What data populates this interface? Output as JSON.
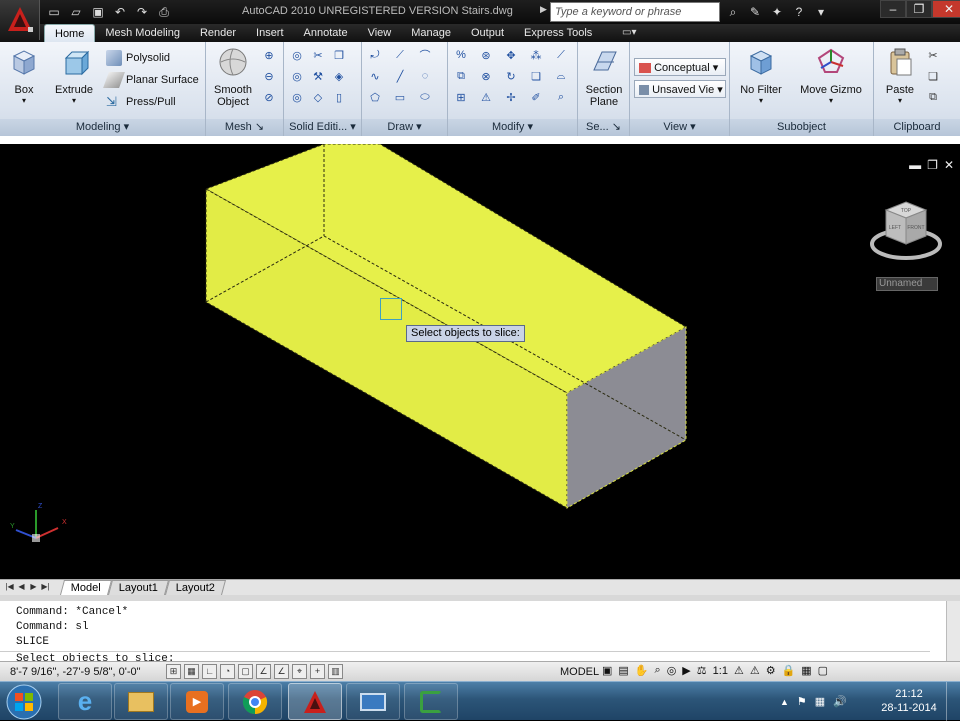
{
  "window": {
    "title": "AutoCAD 2010    UNREGISTERED VERSION         Stairs.dwg",
    "search_placeholder": "Type a keyword or phrase",
    "controls": [
      "minimize",
      "restore",
      "close"
    ]
  },
  "qat": {
    "icons": [
      "new-icon",
      "open-icon",
      "save-icon",
      "undo-icon",
      "redo-icon",
      "plot-icon"
    ]
  },
  "ribbon": {
    "tabs": [
      "Home",
      "Mesh Modeling",
      "Render",
      "Insert",
      "Annotate",
      "View",
      "Manage",
      "Output",
      "Express Tools"
    ],
    "active_tab": "Home",
    "panels": {
      "modeling": {
        "title": "Modeling",
        "box": "Box",
        "extrude": "Extrude",
        "polysolid": "Polysolid",
        "planar_surface": "Planar Surface",
        "press_pull": "Press/Pull"
      },
      "mesh": {
        "title": "Mesh",
        "smooth_object_1": "Smooth",
        "smooth_object_2": "Object"
      },
      "solid_editing": {
        "title": "Solid Editi..."
      },
      "draw": {
        "title": "Draw"
      },
      "modify": {
        "title": "Modify"
      },
      "section": {
        "title": "Se...",
        "section_plane_1": "Section",
        "section_plane_2": "Plane"
      },
      "view": {
        "title": "View",
        "visual_style": "Conceptual",
        "named_view": "Unsaved Vie"
      },
      "subobject": {
        "title": "Subobject",
        "no_filter": "No Filter",
        "move_gizmo": "Move Gizmo"
      },
      "clipboard": {
        "title": "Clipboard",
        "paste": "Paste"
      }
    }
  },
  "viewport": {
    "tooltip": "Select objects to slice:",
    "viewcube_label": "Unnamed",
    "viewcube_faces": {
      "top": "TOP",
      "left": "LEFT",
      "front": "FRONT"
    },
    "ucs": {
      "x": "X",
      "y": "Y",
      "z": "Z"
    },
    "colors": {
      "solid_face": "#e6f04a",
      "end_face": "#8c8c94",
      "background": "#000000"
    }
  },
  "layout_tabs": [
    "Model",
    "Layout1",
    "Layout2"
  ],
  "active_layout": "Model",
  "command_line": {
    "history": [
      "Command: *Cancel*",
      "Command: sl",
      "SLICE"
    ],
    "prompt": "Select objects to slice:"
  },
  "status_bar": {
    "coordinates": "8'-7 9/16\",  -27'-9 5/8\", 0'-0\"",
    "model": "MODEL",
    "annotation_scale": "1:1"
  },
  "taskbar": {
    "apps": [
      "internet-explorer",
      "file-explorer",
      "media-player",
      "chrome",
      "autocad",
      "remote-desktop",
      "camtasia"
    ],
    "time": "21:12",
    "date": "28-11-2014"
  }
}
